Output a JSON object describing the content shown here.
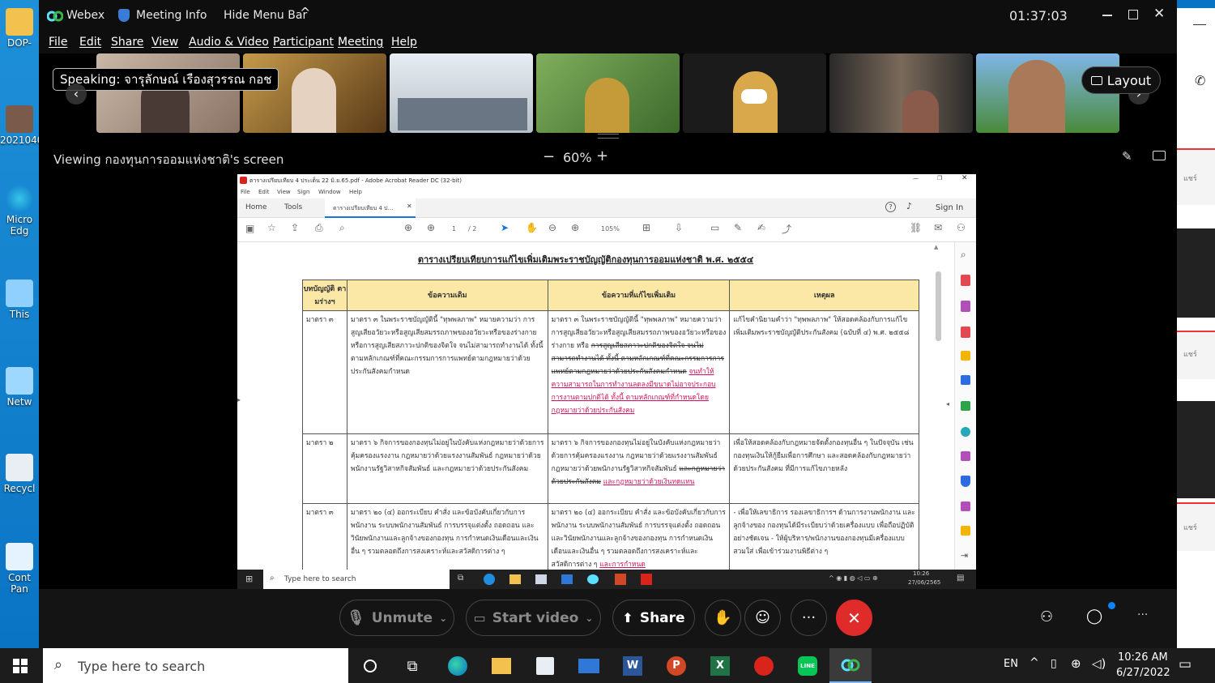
{
  "webex": {
    "app_name": "Webex",
    "meeting_info": "Meeting Info",
    "hide_menu_bar": "Hide Menu Bar",
    "timer": "01:37:03",
    "menu": [
      "File",
      "Edit",
      "Share",
      "View",
      "Audio & Video",
      "Participant",
      "Meeting",
      "Help"
    ],
    "speaking_label": "Speaking: จารุลักษณ์ เรืองสุวรรณ กอช",
    "layout_label": "Layout",
    "viewing_label": "Viewing กองทุนการออมแห่งชาติ's screen",
    "zoom_minus": "−",
    "zoom_level": "60%",
    "zoom_plus": "+",
    "controls": {
      "unmute": "Unmute",
      "start_video": "Start video",
      "share": "Share"
    },
    "colors": {
      "accent": "#0b84ff",
      "end": "#e02b2b",
      "bg": "#000000"
    }
  },
  "acrobat": {
    "window_title": "ตารางเปรียบเทียบ 4 ประเด็น 22 มิ.ย.65.pdf - Adobe Acrobat Reader DC (32-bit)",
    "menu": [
      "File",
      "Edit",
      "View",
      "Sign",
      "Window",
      "Help"
    ],
    "tabs": {
      "home": "Home",
      "tools": "Tools",
      "doc": "ตารางเปรียบเทียบ 4 ป...",
      "sign_in": "Sign In"
    },
    "page_current": "1",
    "page_total": "/ 2",
    "zoom": "105%",
    "doc_title": "ตารางเปรียบเทียบการแก้ไขเพิ่มเติมพระราชบัญญัติกองทุนการออมแห่งชาติ พ.ศ. ๒๕๕๔",
    "table": {
      "headers": [
        "บทบัญญัติ ตามร่างฯ",
        "ข้อความเดิม",
        "ข้อความที่แก้ไขเพิ่มเติม",
        "เหตุผล"
      ],
      "rows": [
        {
          "section": "มาตรา ๓",
          "old": "มาตรา ๓ ในพระราชบัญญัตินี้ \"ทุพพลภาพ\" หมายความว่า การสูญเสียอวัยวะหรือสูญเสียสมรรถภาพของอวัยวะหรือของร่างกาย หรือการสูญเสียสภาวะปกติของจิตใจ จนไม่สามารถทำงานได้ ทั้งนี้ ตามหลักเกณฑ์ที่คณะกรรมการการแพทย์ตามกฎหมายว่าด้วยประกันสังคมกำหนด",
          "new": "มาตรา ๓ ในพระราชบัญญัตินี้ \"ทุพพลภาพ\" หมายความว่า การสูญเสียอวัยวะหรือสูญเสียสมรรถภาพของอวัยวะหรือของร่างกาย หรือ",
          "new_strike": "การสูญเสียสภาวะปกติของจิตใจ จนไม่สามารถทำงานได้ ทั้งนี้ ตามหลักเกณฑ์ที่คณะกรรมการการแพทย์ตามกฎหมายว่าด้วยประกันสังคมกำหนด",
          "new_red": "จนทำให้ความสามารถในการทำงานลดลงมีขนาดไม่อาจประกอบการงานตามปกติได้ ทั้งนี้ ตามหลักเกณฑ์ที่กำหนดโดยกฎหมายว่าด้วยประกันสังคม",
          "reason": "แก้ไขคำนิยามคำว่า \"ทุพพลภาพ\" ให้สอดคล้องกับการแก้ไขเพิ่มเติมพระราชบัญญัติประกันสังคม (ฉบับที่ ๔) พ.ศ. ๒๕๕๘"
        },
        {
          "section": "มาตรา ๒",
          "old": "มาตรา ๖ กิจการของกองทุนไม่อยู่ในบังคับแห่งกฎหมายว่าด้วยการคุ้มครองแรงงาน กฎหมายว่าด้วยแรงงานสัมพันธ์ กฎหมายว่าด้วยพนักงานรัฐวิสาหกิจสัมพันธ์ และกฎหมายว่าด้วยประกันสังคม",
          "new": "มาตรา ๖ กิจการของกองทุนไม่อยู่ในบังคับแห่งกฎหมายว่าด้วยการคุ้มครองแรงงาน กฎหมายว่าด้วยแรงงานสัมพันธ์ กฎหมายว่าด้วยพนักงานรัฐวิสาหกิจสัมพันธ์",
          "new_strike": "และกฎหมายว่าด้วยประกันสังคม",
          "new_red": "และกฎหมายว่าด้วยเงินทดแทน",
          "reason": "เพื่อให้สอดคล้องกับกฎหมายจัดตั้งกองทุนอื่น ๆ ในปัจจุบัน เช่น กองทุนเงินให้กู้ยืมเพื่อการศึกษา และสอดคล้องกับกฎหมายว่าด้วยประกันสังคม ที่มีการแก้ไขภายหลัง"
        },
        {
          "section": "มาตรา ๓",
          "old": "มาตรา ๒๐ (๔) ออกระเบียบ คำสั่ง และข้อบังคับเกี่ยวกับการพนักงาน ระบบพนักงานสัมพันธ์ การบรรจุแต่งตั้ง ถอดถอน และวินัยพนักงานและลูกจ้างของกองทุน การกำหนดเงินเดือนและเงินอื่น ๆ รวมตลอดถึงการสงเคราะห์และสวัสดิการต่าง ๆ",
          "new": "มาตรา ๒๐ (๔) ออกระเบียบ คำสั่ง และข้อบังคับเกี่ยวกับการพนักงาน ระบบพนักงานสัมพันธ์ การบรรจุแต่งตั้ง ถอดถอน และวินัยพนักงานและลูกจ้างของกองทุน การกำหนดเงินเดือนและเงินอื่น ๆ รวมตลอดถึงการสงเคราะห์และสวัสดิการต่าง ๆ",
          "new_strike": "",
          "new_red": "และการกำหนด",
          "reason": "- เพื่อให้เลขาธิการ รองเลขาธิการฯ ด้านการงานพนักงาน และลูกจ้างของ กองทุนได้มีระเบียบว่าด้วยเครื่องแบบ เพื่อถือปฏิบัติอย่างชัดเจน - ให้ผู้บริหาร/พนักงานของกองทุนมีเครื่องแบบสวมใส่ เพื่อเข้าร่วมงานพิธีต่าง ๆ"
        }
      ]
    },
    "inner_taskbar": {
      "search": "Type here to search",
      "time": "10:26",
      "date": "27/06/2565"
    }
  },
  "desktop": {
    "icons": [
      "DOP-",
      "2021040",
      "Micro Edg",
      "This",
      "Netw",
      "Recycl",
      "Cont Pan"
    ]
  },
  "taskbar": {
    "search_placeholder": "Type here to search",
    "lang": "EN",
    "time": "10:26 AM",
    "date": "6/27/2022"
  },
  "right_app": {
    "snippets": [
      "แชร์",
      "แชร์",
      "แชร์"
    ]
  }
}
